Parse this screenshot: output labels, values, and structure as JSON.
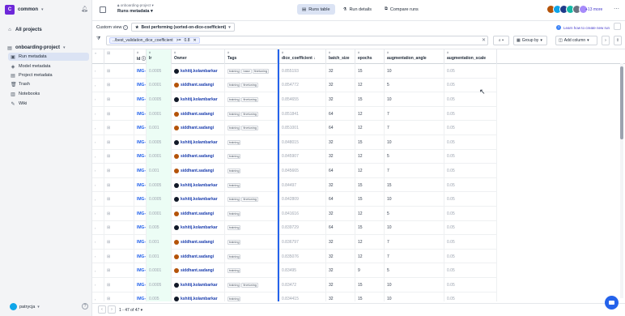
{
  "sidebar": {
    "workspace": {
      "avatar": "C",
      "name": "common"
    },
    "all_projects": "All projects",
    "project": "onboarding-project",
    "items": [
      {
        "label": "Run metadata",
        "icon": "runs-icon",
        "active": true
      },
      {
        "label": "Model metadata",
        "icon": "models-icon",
        "active": false
      },
      {
        "label": "Project metadata",
        "icon": "metadata-icon",
        "active": false
      },
      {
        "label": "Trash",
        "icon": "trash-icon",
        "active": false
      },
      {
        "label": "Notebooks",
        "icon": "notebook-icon",
        "active": false
      },
      {
        "label": "Wiki",
        "icon": "wiki-icon",
        "active": false
      }
    ],
    "user": "patrycja"
  },
  "header": {
    "project": "onboarding-project",
    "title": "Runs metadata",
    "tabs": [
      {
        "label": "Runs table",
        "active": true
      },
      {
        "label": "Run details",
        "active": false
      },
      {
        "label": "Compare runs",
        "active": false
      }
    ],
    "more_members": "+13 more",
    "member_colors": [
      "#b45309",
      "#0ea5e9",
      "#1e3a8a",
      "#14b8a6",
      "#6b7280",
      "#a78bfa"
    ]
  },
  "view": {
    "label": "Custom view",
    "selected": "Best performing (sorted-on-dice-coefficient)",
    "learn": "Learn how to create new run"
  },
  "filter": {
    "field": "../best_validation_dice_coefficient",
    "operator": ">=",
    "value": "0.8"
  },
  "toolbar": {
    "group_by": "Group by",
    "add_column": "Add column"
  },
  "columns": [
    {
      "type": "#",
      "name": "Id"
    },
    {
      "type": "#",
      "name": "lr"
    },
    {
      "type": "#",
      "name": "Owner"
    },
    {
      "type": "#",
      "name": "Tags"
    },
    {
      "type": "#",
      "name": "dice_coefficient"
    },
    {
      "type": "#",
      "name": "batch_size"
    },
    {
      "type": "#",
      "name": "epochs"
    },
    {
      "type": "#",
      "name": "augmentation_angle"
    },
    {
      "type": "#",
      "name": "augmentation_scale"
    }
  ],
  "rows": [
    {
      "id": "IMG-155",
      "lr": "0.0005",
      "owner": "kshitij.kolambarkar",
      "tags": [
        "training",
        "base",
        "finetuning"
      ],
      "dice": "0.855193",
      "batch": "32",
      "epochs": "15",
      "angle": "10",
      "scale": "0.05"
    },
    {
      "id": "IMG-206",
      "lr": "0.0001",
      "owner": "siddhant.sadangi",
      "tags": [
        "training",
        "finetuning"
      ],
      "dice": "0.854772",
      "batch": "32",
      "epochs": "12",
      "angle": "5",
      "scale": "0.05"
    },
    {
      "id": "IMG-157",
      "lr": "0.0005",
      "owner": "kshitij.kolambarkar",
      "tags": [
        "training",
        "finetuning"
      ],
      "dice": "0.854655",
      "batch": "32",
      "epochs": "15",
      "angle": "10",
      "scale": "0.05"
    },
    {
      "id": "IMG-232",
      "lr": "0.0001",
      "owner": "siddhant.sadangi",
      "tags": [
        "training",
        "finetuning"
      ],
      "dice": "0.851841",
      "batch": "64",
      "epochs": "12",
      "angle": "7",
      "scale": "0.05"
    },
    {
      "id": "IMG-223",
      "lr": "0.001",
      "owner": "siddhant.sadangi",
      "tags": [
        "training",
        "finetuning"
      ],
      "dice": "0.851001",
      "batch": "64",
      "epochs": "12",
      "angle": "7",
      "scale": "0.05"
    },
    {
      "id": "IMG-151",
      "lr": "0.0005",
      "owner": "kshitij.kolambarkar",
      "tags": [
        "training"
      ],
      "dice": "0.848015",
      "batch": "32",
      "epochs": "15",
      "angle": "10",
      "scale": "0.05"
    },
    {
      "id": "IMG-199",
      "lr": "0.0001",
      "owner": "siddhant.sadangi",
      "tags": [
        "training"
      ],
      "dice": "0.845907",
      "batch": "32",
      "epochs": "12",
      "angle": "5",
      "scale": "0.05"
    },
    {
      "id": "IMG-225",
      "lr": "0.001",
      "owner": "siddhant.sadangi",
      "tags": [
        "training"
      ],
      "dice": "0.845665",
      "batch": "64",
      "epochs": "12",
      "angle": "7",
      "scale": "0.05"
    },
    {
      "id": "IMG-182",
      "lr": "0.0005",
      "owner": "kshitij.kolambarkar",
      "tags": [
        "training"
      ],
      "dice": "0.84497",
      "batch": "32",
      "epochs": "15",
      "angle": "15",
      "scale": "0.05"
    },
    {
      "id": "IMG-156",
      "lr": "0.0005",
      "owner": "kshitij.kolambarkar",
      "tags": [
        "training",
        "finetuning"
      ],
      "dice": "0.842809",
      "batch": "64",
      "epochs": "15",
      "angle": "10",
      "scale": "0.05"
    },
    {
      "id": "IMG-198",
      "lr": "0.0001",
      "owner": "siddhant.sadangi",
      "tags": [
        "training"
      ],
      "dice": "0.841616",
      "batch": "32",
      "epochs": "12",
      "angle": "5",
      "scale": "0.05"
    },
    {
      "id": "IMG-148",
      "lr": "0.005",
      "owner": "kshitij.kolambarkar",
      "tags": [
        "training"
      ],
      "dice": "0.839729",
      "batch": "64",
      "epochs": "15",
      "angle": "10",
      "scale": "0.05"
    },
    {
      "id": "IMG-224",
      "lr": "0.001",
      "owner": "siddhant.sadangi",
      "tags": [
        "training"
      ],
      "dice": "0.836797",
      "batch": "32",
      "epochs": "12",
      "angle": "7",
      "scale": "0.05"
    },
    {
      "id": "IMG-222",
      "lr": "0.001",
      "owner": "siddhant.sadangi",
      "tags": [
        "training"
      ],
      "dice": "0.835076",
      "batch": "32",
      "epochs": "12",
      "angle": "7",
      "scale": "0.05"
    },
    {
      "id": "IMG-204",
      "lr": "0.0001",
      "owner": "siddhant.sadangi",
      "tags": [
        "training"
      ],
      "dice": "0.83495",
      "batch": "32",
      "epochs": "9",
      "angle": "5",
      "scale": "0.05"
    },
    {
      "id": "IMG-153",
      "lr": "0.0005",
      "owner": "kshitij.kolambarkar",
      "tags": [
        "training",
        "finetuning"
      ],
      "dice": "0.83472",
      "batch": "32",
      "epochs": "15",
      "angle": "10",
      "scale": "0.05"
    },
    {
      "id": "IMG-147",
      "lr": "0.005",
      "owner": "kshitij.kolambarkar",
      "tags": [
        "training"
      ],
      "dice": "0.834415",
      "batch": "32",
      "epochs": "15",
      "angle": "10",
      "scale": "0.05"
    }
  ],
  "pager": {
    "label": "1 - 47 of 47"
  },
  "colors": {
    "accent": "#2563eb",
    "active_bg": "#dbe3f4",
    "owner_k": "#111827",
    "owner_s": "#b45309"
  }
}
